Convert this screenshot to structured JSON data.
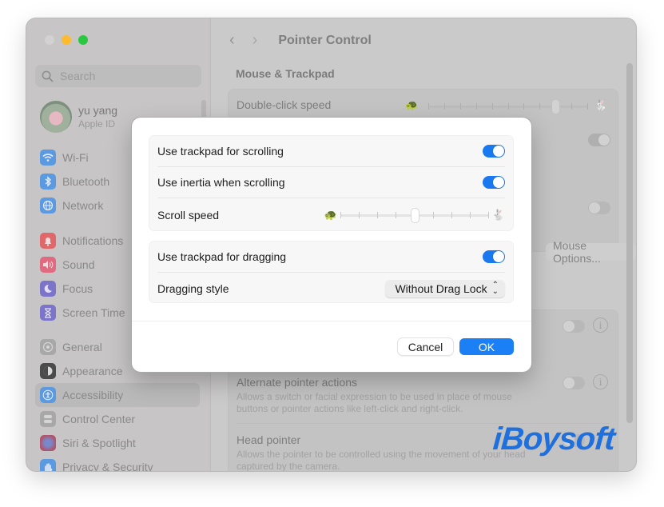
{
  "window": {
    "traffic_lights": [
      "close",
      "minimize",
      "maximize"
    ]
  },
  "sidebar": {
    "search_placeholder": "Search",
    "profile": {
      "name": "yu yang",
      "subtitle": "Apple ID"
    },
    "groups": [
      [
        {
          "label": "Wi-Fi",
          "icon": "wifi-icon",
          "color": "#5b9ae0"
        },
        {
          "label": "Bluetooth",
          "icon": "bluetooth-icon",
          "color": "#5b9ae0"
        },
        {
          "label": "Network",
          "icon": "globe-icon",
          "color": "#5b9ae0"
        }
      ],
      [
        {
          "label": "Notifications",
          "icon": "bell-icon",
          "color": "#e0686a"
        },
        {
          "label": "Sound",
          "icon": "speaker-icon",
          "color": "#e06a80"
        },
        {
          "label": "Focus",
          "icon": "moon-icon",
          "color": "#7c74c8"
        },
        {
          "label": "Screen Time",
          "icon": "hourglass-icon",
          "color": "#7c74c8"
        }
      ],
      [
        {
          "label": "General",
          "icon": "gear-icon",
          "color": "#a9a8a8"
        },
        {
          "label": "Appearance",
          "icon": "appearance-icon",
          "color": "#4b4b4b"
        },
        {
          "label": "Accessibility",
          "icon": "accessibility-icon",
          "color": "#5b9ae0",
          "selected": true
        },
        {
          "label": "Control Center",
          "icon": "control-center-icon",
          "color": "#a9a8a8"
        },
        {
          "label": "Siri & Spotlight",
          "icon": "siri-icon",
          "color": "#b0546c"
        },
        {
          "label": "Privacy & Security",
          "icon": "hand-icon",
          "color": "#5b9ae0"
        }
      ]
    ]
  },
  "main": {
    "back_icon": "chevron-left-icon",
    "forward_icon": "chevron-right-icon",
    "title": "Pointer Control",
    "section_heading": "Mouse & Trackpad",
    "double_click_speed": {
      "label": "Double-click speed",
      "value_step": 9,
      "steps": 11
    },
    "mouse_options_label": "Mouse Options...",
    "alternate_pointer": {
      "label": "Alternate pointer actions",
      "description_line1": "Allows a switch or facial expression to be used in place of mouse",
      "description_line2": "buttons or pointer actions like left-click and right-click.",
      "enabled": false
    },
    "head_pointer": {
      "label": "Head pointer",
      "description_line1": "Allows the pointer to be controlled using the movement of your head",
      "description_line2": "captured by the camera.",
      "enabled": false
    }
  },
  "dialog": {
    "scrolling_group": {
      "use_trackpad_scrolling": {
        "label": "Use trackpad for scrolling",
        "enabled": true
      },
      "use_inertia": {
        "label": "Use inertia when scrolling",
        "enabled": true
      },
      "scroll_speed": {
        "label": "Scroll speed",
        "value_step": 5,
        "steps": 9
      }
    },
    "dragging_group": {
      "use_trackpad_dragging": {
        "label": "Use trackpad for dragging",
        "enabled": true
      },
      "dragging_style": {
        "label": "Dragging style",
        "selected": "Without Drag Lock"
      }
    },
    "cancel_label": "Cancel",
    "ok_label": "OK"
  },
  "watermark": "iBoysoft",
  "colors": {
    "accent": "#1b7ff5",
    "toggle_on": "#1b79f0",
    "watermark": "#1f6fdc"
  }
}
